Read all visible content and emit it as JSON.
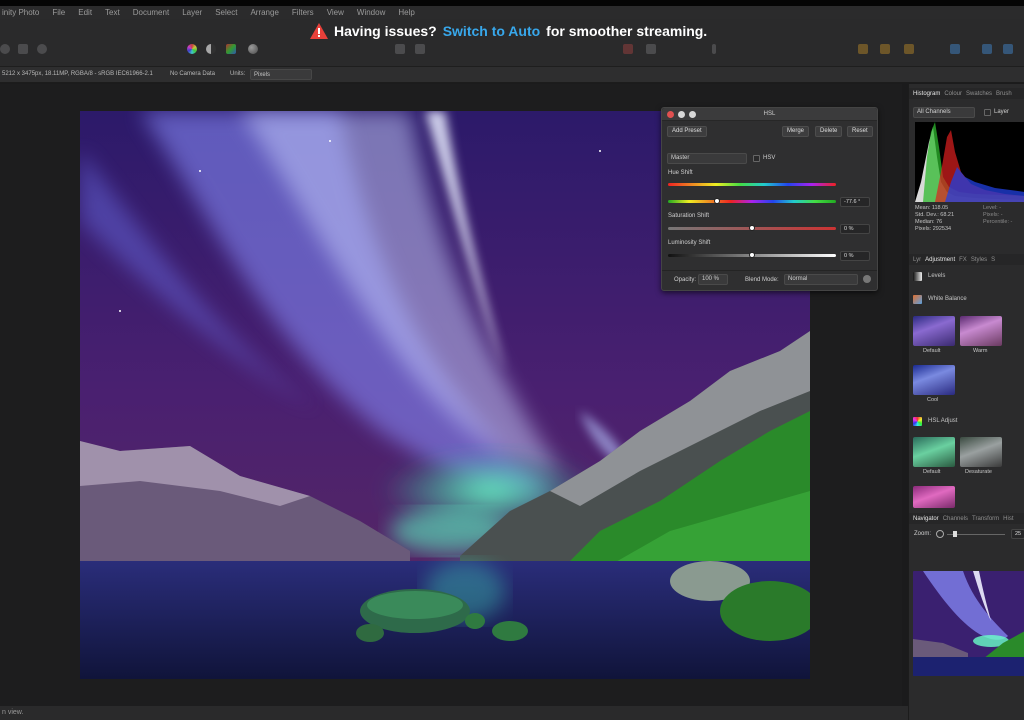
{
  "menu": [
    "inity Photo",
    "File",
    "Edit",
    "Text",
    "Document",
    "Layer",
    "Select",
    "Arrange",
    "Filters",
    "View",
    "Window",
    "Help"
  ],
  "banner": {
    "prefix": "Having issues?",
    "link": "Switch to Auto",
    "suffix": "for smoother streaming."
  },
  "context": {
    "doc_info": "5212 x 3475px, 18.11MP, RGBA/8 - sRGB IEC61966-2.1",
    "camera": "No Camera Data",
    "units_label": "Units:",
    "units_value": "Pixels"
  },
  "hsl": {
    "title": "HSL",
    "add_preset": "Add Preset",
    "merge": "Merge",
    "delete": "Delete",
    "reset": "Reset",
    "channel": "Master",
    "hsv_label": "HSV",
    "hue_label": "Hue Shift",
    "hue_value": "-77.6 °",
    "hue_fraction": 0.29,
    "saturation_label": "Saturation Shift",
    "saturation_value": "0 %",
    "saturation_fraction": 0.5,
    "luminosity_label": "Luminosity Shift",
    "luminosity_value": "0 %",
    "luminosity_fraction": 0.5,
    "opacity_label": "Opacity:",
    "opacity_value": "100 %",
    "blend_label": "Blend Mode:",
    "blend_value": "Normal"
  },
  "panel": {
    "top_tabs": [
      "Histogram",
      "Colour",
      "Swatches",
      "Brush"
    ],
    "channels": "All Channels",
    "layer_label": "Layer",
    "stats_left": [
      "Mean: 118.05",
      "Std. Dev.: 68.21",
      "Median: 76",
      "Pixels: 292534"
    ],
    "stats_right": [
      "Level: -",
      "Pixels: -",
      "Percentile: -"
    ],
    "mid_tabs": [
      "Lyr",
      "Adjustment",
      "FX",
      "Styles",
      "S"
    ],
    "adjustments": [
      {
        "name": "Levels",
        "color": "#dddddd"
      },
      {
        "name": "White Balance",
        "color": "#5aa0e0"
      },
      {
        "name": "HSL Adjust",
        "color": "#d84ad0"
      }
    ],
    "wb_presets": [
      "Default",
      "Warm",
      "Cool"
    ],
    "hsl_presets": [
      "Default",
      "Desaturate"
    ],
    "nav_tabs": [
      "Navigator",
      "Channels",
      "Transform",
      "Hist"
    ],
    "zoom_label": "Zoom:",
    "zoom_value": "25"
  },
  "status": "n view."
}
